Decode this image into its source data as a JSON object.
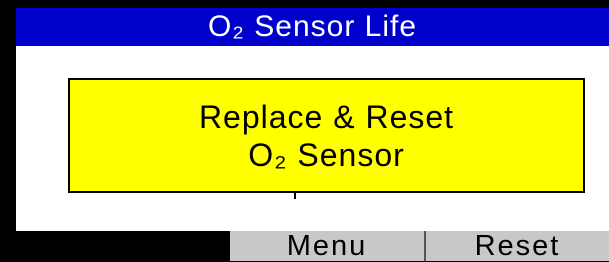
{
  "title_bar": {
    "text": "O₂ Sensor Life"
  },
  "alert": {
    "line1": "Replace & Reset",
    "line2": "O₂ Sensor"
  },
  "softkeys": {
    "menu_label": "Menu",
    "reset_label": "Reset"
  },
  "colors": {
    "title_background": "#0000cc",
    "title_text": "#ffffff",
    "content_background": "#ffffff",
    "alert_background": "#ffff00",
    "softkey_background": "#c8c8c8",
    "bezel": "#000000"
  }
}
